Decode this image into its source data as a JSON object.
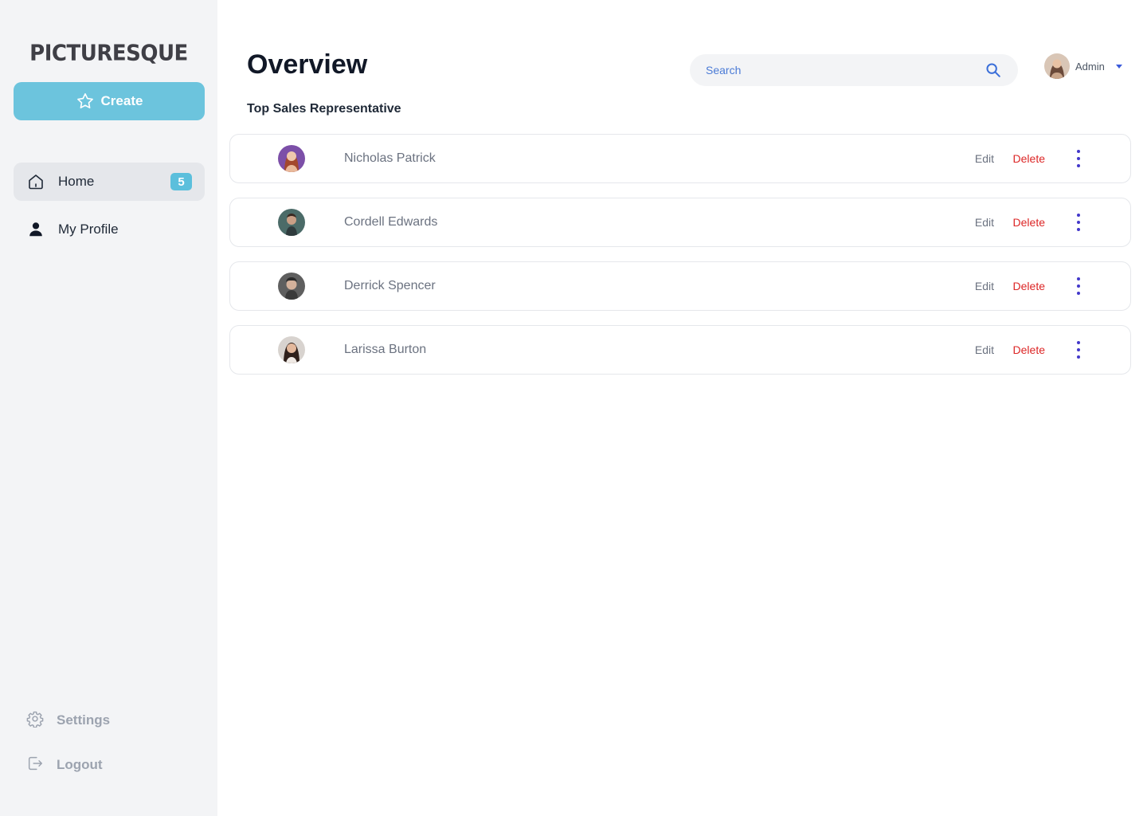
{
  "brand": {
    "name": "PICTURESQUE"
  },
  "sidebar": {
    "create_label": "Create",
    "items": [
      {
        "label": "Home",
        "badge": "5",
        "icon": "home-icon"
      },
      {
        "label": "My Profile",
        "icon": "user-icon"
      }
    ],
    "bottom_items": [
      {
        "label": "Settings",
        "icon": "gear-icon"
      },
      {
        "label": "Logout",
        "icon": "logout-icon"
      }
    ]
  },
  "header": {
    "title": "Overview",
    "search_placeholder": "Search",
    "user_name": "Admin"
  },
  "section": {
    "title": "Top Sales Representative"
  },
  "reps": [
    {
      "name": "Nicholas Patrick",
      "edit": "Edit",
      "delete": "Delete"
    },
    {
      "name": "Cordell Edwards",
      "edit": "Edit",
      "delete": "Delete"
    },
    {
      "name": "Derrick Spencer",
      "edit": "Edit",
      "delete": "Delete"
    },
    {
      "name": "Larissa Burton",
      "edit": "Edit",
      "delete": "Delete"
    }
  ],
  "colors": {
    "accent": "#6cc4dd",
    "badge": "#5bbfdc",
    "delete": "#dc2626",
    "kebab": "#4338ca",
    "sidebar_bg": "#f3f4f6"
  }
}
